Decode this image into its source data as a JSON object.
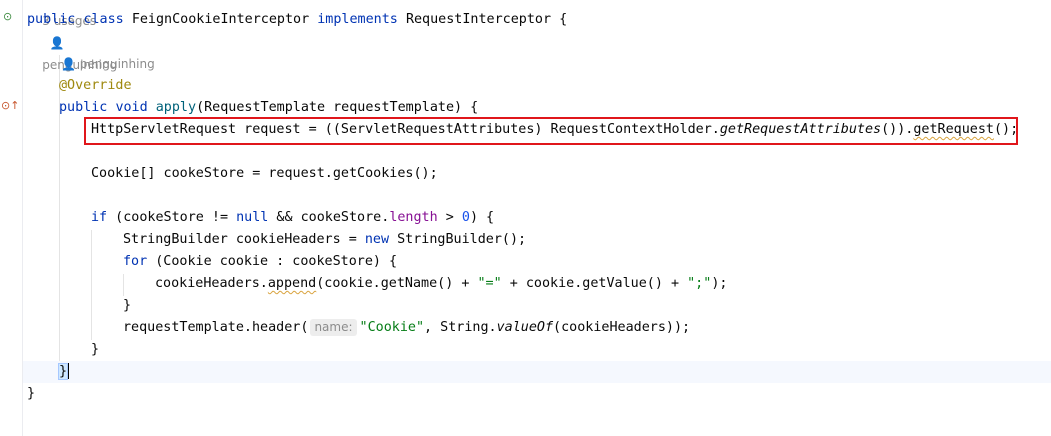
{
  "header_hint": {
    "usages": "3 usages",
    "author": "penguinhing"
  },
  "class_line": {
    "kw_public": "public",
    "kw_class": "class",
    "class_name": "FeignCookieInterceptor",
    "kw_implements": "implements",
    "iface": "RequestInterceptor",
    "brace": "{"
  },
  "method_hint": {
    "author": "penguinhing"
  },
  "override": "@Override",
  "method_sig": {
    "kw_public": "public",
    "kw_void": "void",
    "name": "apply",
    "params": "(RequestTemplate requestTemplate)",
    "brace": "{"
  },
  "line_request": {
    "before": "HttpServletRequest request = ((ServletRequestAttributes) RequestContextHolder.",
    "static_call": "getRequestAttributes",
    "middle": "()).",
    "warned_call": "getRequest",
    "after": "();"
  },
  "line_store": "Cookie[] cookeStore = request.getCookies();",
  "line_if": {
    "kw_if": "if",
    "a": " (cookeStore != ",
    "kw_null": "null",
    "b": " && cookeStore.",
    "field": "length",
    "c": " > ",
    "num": "0",
    "d": ") {"
  },
  "line_sb": {
    "a": "StringBuilder cookieHeaders = ",
    "kw_new": "new",
    "b": " StringBuilder();"
  },
  "line_for": {
    "kw_for": "for",
    "rest": " (Cookie cookie : cookeStore) {"
  },
  "line_append": {
    "a": "cookieHeaders.",
    "warned_call": "append",
    "b": "(cookie.getName() + ",
    "str1": "\"=\"",
    "c": " + cookie.getValue() + ",
    "str2": "\";\"",
    "d": ");"
  },
  "close_for": "}",
  "line_header": {
    "a": "requestTemplate.header(",
    "param_hint": "name:",
    "str": "\"Cookie\"",
    "b": ", String.",
    "static_call": "valueOf",
    "c": "(cookieHeaders));"
  },
  "close_if": "}",
  "close_method": "}",
  "close_class": "}",
  "colors": {
    "keyword": "#0033b3",
    "annotation": "#9e880d",
    "string": "#067d17",
    "number": "#1750eb",
    "field": "#871094",
    "method_decl": "#00627a",
    "highlight_box": "#e0161b"
  },
  "icons": {
    "implementation_gutter": "implementation-icon",
    "override_gutter": "override-method-icon",
    "author_hint": "person-icon"
  }
}
